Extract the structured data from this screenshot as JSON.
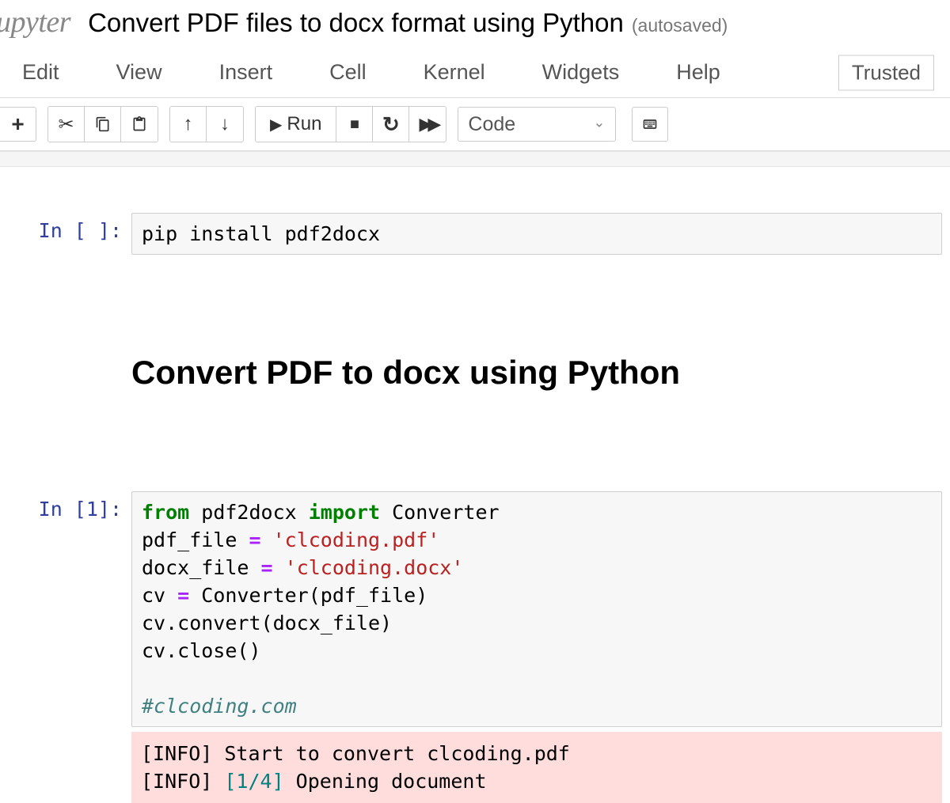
{
  "header": {
    "logo": "upyter",
    "title": "Convert PDF files to docx format using Python",
    "autosaved": "(autosaved)"
  },
  "menubar": {
    "items": [
      "Edit",
      "View",
      "Insert",
      "Cell",
      "Kernel",
      "Widgets",
      "Help"
    ],
    "trusted": "Trusted"
  },
  "toolbar": {
    "run_label": "Run",
    "cell_type_selected": "Code"
  },
  "cells": [
    {
      "type": "code",
      "prompt": "In [ ]:",
      "source_plain": "pip install pdf2docx"
    },
    {
      "type": "markdown",
      "heading": "Convert PDF to docx using Python"
    },
    {
      "type": "code",
      "prompt": "In [1]:",
      "source_tokens": [
        [
          "kw-green",
          "from"
        ],
        [
          "",
          " pdf2docx "
        ],
        [
          "kw-green",
          "import"
        ],
        [
          "",
          " Converter\n"
        ],
        [
          "",
          "pdf_file "
        ],
        [
          "op",
          "="
        ],
        [
          "",
          " "
        ],
        [
          "str",
          "'clcoding.pdf'"
        ],
        [
          "",
          "\n"
        ],
        [
          "",
          "docx_file "
        ],
        [
          "op",
          "="
        ],
        [
          "",
          " "
        ],
        [
          "str",
          "'clcoding.docx'"
        ],
        [
          "",
          "\n"
        ],
        [
          "",
          "cv "
        ],
        [
          "op",
          "="
        ],
        [
          "",
          " Converter(pdf_file)\n"
        ],
        [
          "",
          "cv.convert(docx_file)\n"
        ],
        [
          "",
          "cv.close()\n"
        ],
        [
          "",
          "\n"
        ],
        [
          "cm",
          "#clcoding.com"
        ]
      ],
      "output_tokens": [
        [
          "",
          "[INFO] Start to convert clcoding.pdf\n"
        ],
        [
          "",
          "[INFO] "
        ],
        [
          "num-teal",
          "[1/4]"
        ],
        [
          "",
          " Opening document"
        ]
      ]
    }
  ]
}
